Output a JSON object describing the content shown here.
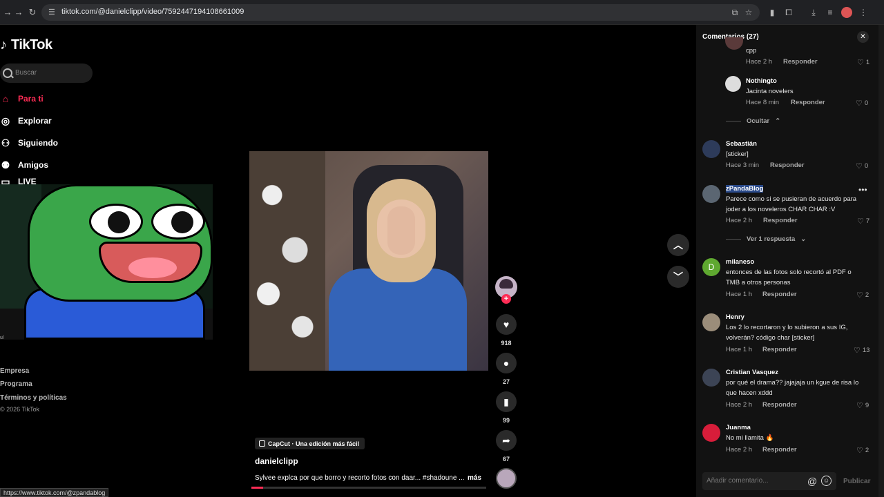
{
  "browser": {
    "url": "tiktok.com/@danielclipp/video/7592447194108661009"
  },
  "sidebar": {
    "logo": "TikTok",
    "search_placeholder": "Buscar",
    "items": [
      {
        "label": "Para ti",
        "icon": "home-icon"
      },
      {
        "label": "Explorar",
        "icon": "compass-icon"
      },
      {
        "label": "Siguiendo",
        "icon": "user-follow-icon"
      },
      {
        "label": "Amigos",
        "icon": "friends-icon"
      },
      {
        "label": "LIVE",
        "icon": "live-icon"
      }
    ],
    "left_caption": "ul",
    "footer_links": [
      "Empresa",
      "Programa",
      "Términos y políticas"
    ],
    "copyright": "© 2026 TikTok",
    "status_url": "https://www.tiktok.com/@zpandablog"
  },
  "video": {
    "capcut_label": "CapCut · Una edición más fácil",
    "author": "danielclipp",
    "description": "Sylvee explca por que borro y recorto fotos con daar... #shadoune ...",
    "more": "más",
    "progress": 0.05
  },
  "actions": {
    "likes": "918",
    "comments": "27",
    "saves": "99",
    "shares": "67"
  },
  "comments_panel": {
    "title": "Comentarios (27)",
    "reply_label": "Responder",
    "hide_label": "Ocultar",
    "view_reply_label": "Ver 1 respuesta",
    "input_placeholder": "Añadir comentario...",
    "publish_label": "Publicar",
    "comments": [
      {
        "user": "",
        "text": "cpp",
        "time": "Hace 2 h",
        "likes": "1"
      },
      {
        "user": "Nothingto",
        "text": "Jacinta novelers",
        "time": "Hace 8 min",
        "likes": "0"
      },
      {
        "user": "Sebastián",
        "text": "[sticker]",
        "time": "Hace 3 min",
        "likes": "0"
      },
      {
        "user": "zPandaBlog",
        "text": "Parece como si se pusieran de acuerdo para joder a los noveleros CHAR CHAR :V",
        "time": "Hace 2 h",
        "likes": "7"
      },
      {
        "user": "milaneso",
        "text": "entonces de las fotos solo recortó al PDF o TMB a otros personas",
        "time": "Hace 1 h",
        "likes": "2"
      },
      {
        "user": "Henry",
        "text": "Los 2 lo recortaron y lo subieron a sus IG, volverán? código char [sticker]",
        "time": "Hace 1 h",
        "likes": "13"
      },
      {
        "user": "Cristian Vasquez",
        "text": "por qué el drama?? jajajaja un kgue de risa lo que hacen xddd",
        "time": "Hace 2 h",
        "likes": "9"
      },
      {
        "user": "Juanma",
        "text": "No mi llamita 🔥",
        "time": "Hace 2 h",
        "likes": "2"
      }
    ]
  },
  "colors": {
    "accent": "#fe2c55",
    "panel_bg": "#121212"
  }
}
